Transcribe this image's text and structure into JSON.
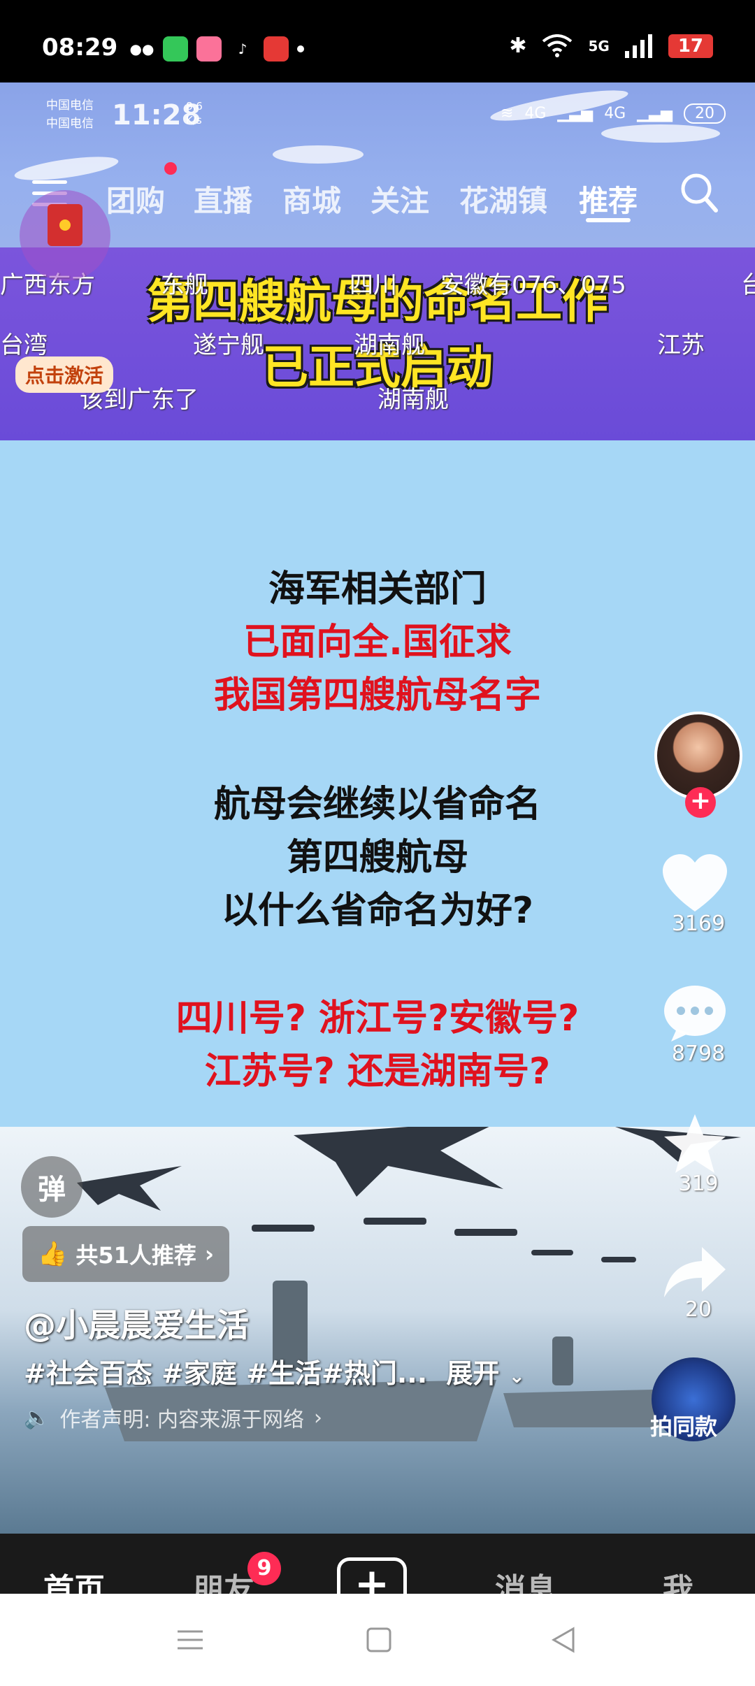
{
  "status_bar": {
    "time": "08:29",
    "network": "5G",
    "battery": "17"
  },
  "inner_status": {
    "carrier_1": "中国电信",
    "carrier_2": "中国电信",
    "time": "11:28",
    "speed_value": "8.6",
    "speed_unit": "K/s",
    "net_1": "4G",
    "net_2": "4G",
    "battery": "20"
  },
  "top_nav": {
    "tabs": [
      "团购",
      "直播",
      "商城",
      "关注",
      "花湖镇",
      "推荐"
    ],
    "active_tab": "推荐"
  },
  "red_packet": {
    "label": "点击激活"
  },
  "video": {
    "title_line_1": "第四艘航母的命名工作",
    "title_line_2": "已正式启动",
    "danmaku": [
      "广西东方",
      "东舰",
      "四川",
      "安徽有076、075",
      "台",
      "台湾",
      "遂宁舰",
      "湖南舰",
      "江苏",
      "该到广东了",
      "湖南舰"
    ],
    "text_lines": [
      {
        "text": "海军相关部门",
        "color": "black"
      },
      {
        "text": "已面向全.国征求",
        "color": "red"
      },
      {
        "text": "我国第四艘航母名字",
        "color": "red"
      },
      {
        "text": "航母会继续以省命名",
        "color": "black"
      },
      {
        "text": "第四艘航母",
        "color": "black"
      },
      {
        "text": "以什么省命名为好?",
        "color": "black"
      },
      {
        "text": "四川号? 浙江号?安徽号?",
        "color": "red"
      },
      {
        "text": "江苏号? 还是湖南号?",
        "color": "red"
      }
    ]
  },
  "sidebar": {
    "likes": "3169",
    "comments": "8798",
    "favorites": "319",
    "shares": "20"
  },
  "info": {
    "danmu_toggle": "弹",
    "recommend": "共51人推荐",
    "username": "@小晨晨爱生活",
    "hashtags": "#社会百态 #家庭 #生活#热门...",
    "expand": "展开",
    "disclaimer": "作者声明: 内容来源于网络",
    "same_style": "拍同款"
  },
  "bottom_nav": {
    "home": "首页",
    "friends": "朋友",
    "friends_badge": "9",
    "messages": "消息",
    "me": "我",
    "expand": "展开"
  },
  "colors": {
    "accent_red": "#fe2c55",
    "title_yellow": "#ffe524",
    "panel_blue": "#a6d7f6"
  }
}
